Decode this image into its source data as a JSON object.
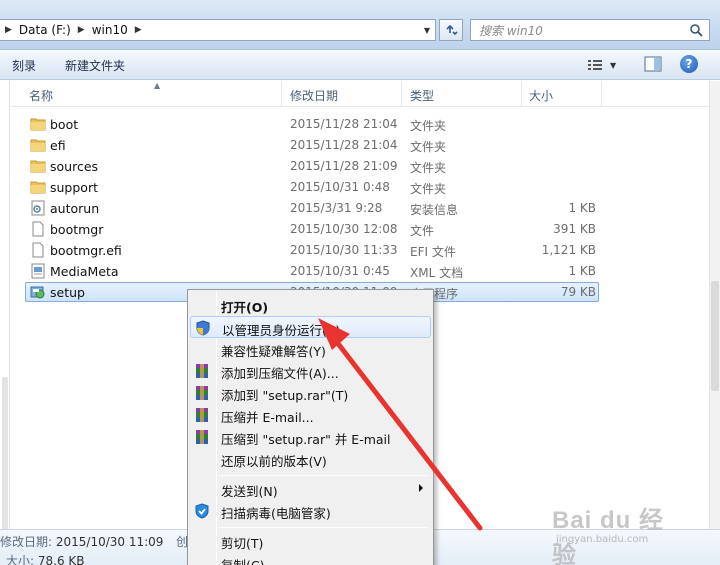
{
  "address_bar": {
    "crumbs": [
      "Data (F:)",
      "win10"
    ],
    "search_placeholder": "搜索 win10"
  },
  "toolbar": {
    "burn_label": "刻录",
    "new_folder_label": "新建文件夹"
  },
  "columns": {
    "name": "名称",
    "date": "修改日期",
    "type": "类型",
    "size": "大小"
  },
  "files": [
    {
      "name": "boot",
      "date": "2015/11/28 21:04",
      "type": "文件夹",
      "size": "",
      "icon": "folder-icon"
    },
    {
      "name": "efi",
      "date": "2015/11/28 21:04",
      "type": "文件夹",
      "size": "",
      "icon": "folder-icon"
    },
    {
      "name": "sources",
      "date": "2015/11/28 21:09",
      "type": "文件夹",
      "size": "",
      "icon": "folder-icon"
    },
    {
      "name": "support",
      "date": "2015/10/31 0:48",
      "type": "文件夹",
      "size": "",
      "icon": "folder-icon"
    },
    {
      "name": "autorun",
      "date": "2015/3/31 9:28",
      "type": "安装信息",
      "size": "1 KB",
      "icon": "settings-file-icon"
    },
    {
      "name": "bootmgr",
      "date": "2015/10/30 12:08",
      "type": "文件",
      "size": "391 KB",
      "icon": "file-icon"
    },
    {
      "name": "bootmgr.efi",
      "date": "2015/10/30 11:33",
      "type": "EFI 文件",
      "size": "1,121 KB",
      "icon": "file-icon"
    },
    {
      "name": "MediaMeta",
      "date": "2015/10/31 0:45",
      "type": "XML 文档",
      "size": "1 KB",
      "icon": "xml-file-icon"
    },
    {
      "name": "setup",
      "date": "2015/10/30 11:09",
      "type": "应用程序",
      "size": "79 KB",
      "icon": "setup-app-icon"
    }
  ],
  "context_menu": {
    "open": "打开(O)",
    "run_as_admin": "以管理员身份运行(A)",
    "troubleshoot": "兼容性疑难解答(Y)",
    "add_archive": "添加到压缩文件(A)...",
    "add_rar": "添加到 \"setup.rar\"(T)",
    "compress_email": "压缩并 E-mail...",
    "compress_rar_email": "压缩到 \"setup.rar\" 并 E-mail",
    "restore": "还原以前的版本(V)",
    "send_to": "发送到(N)",
    "scan": "扫描病毒(电脑管家)",
    "cut": "剪切(T)",
    "copy": "复制(C)"
  },
  "details": {
    "modified_label": "修改日期:",
    "modified_value": "2015/10/30 11:09",
    "created_label": "创",
    "size_label": "大小:",
    "size_value": "78.6 KB"
  },
  "watermark": {
    "brand": "Bai du 经验",
    "site": "jingyan.baidu.com"
  },
  "colors": {
    "selection": "#cde3fb",
    "annotation_arrow": "#e8332e",
    "accent": "#1d5ab8"
  }
}
